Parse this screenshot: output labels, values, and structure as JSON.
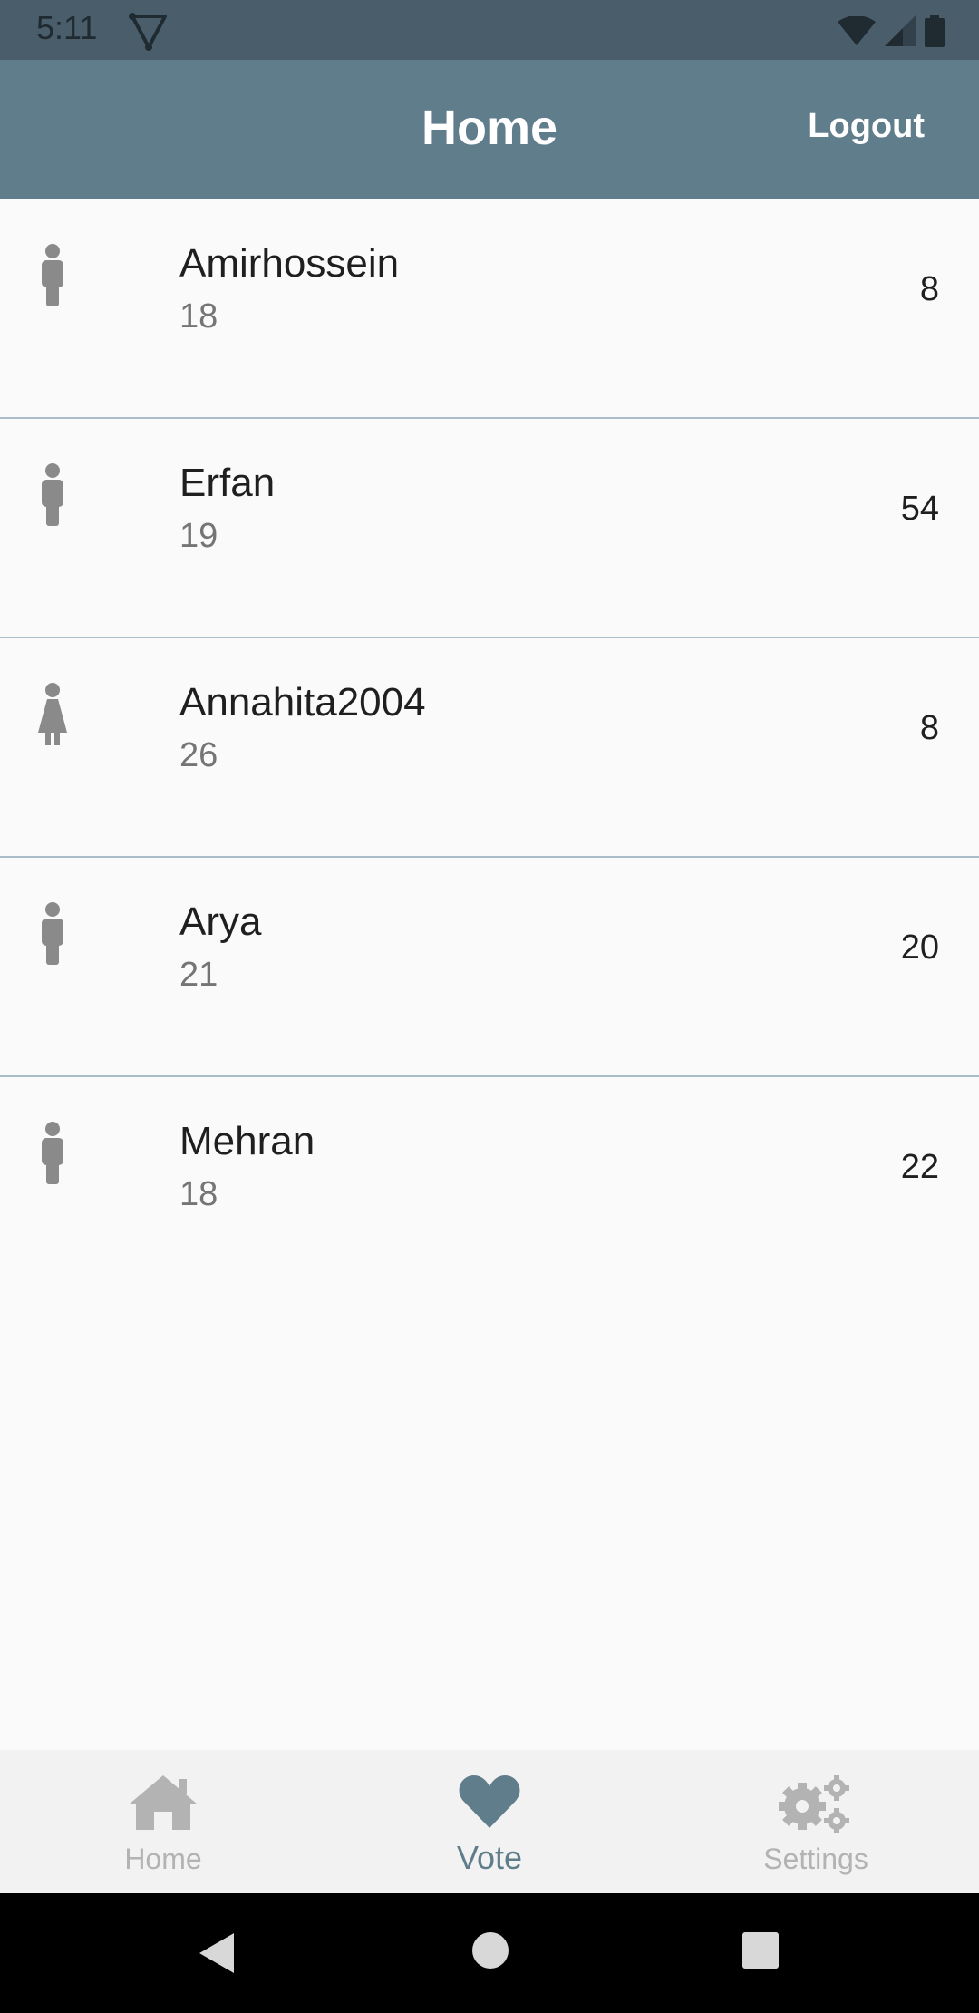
{
  "status_bar": {
    "time": "5:11"
  },
  "app_bar": {
    "title": "Home",
    "logout_label": "Logout"
  },
  "users": [
    {
      "name": "Amirhossein",
      "age": "18",
      "votes": "8",
      "gender_icon": "male-person-icon"
    },
    {
      "name": "Erfan",
      "age": "19",
      "votes": "54",
      "gender_icon": "male-person-icon"
    },
    {
      "name": "Annahita2004",
      "age": "26",
      "votes": "8",
      "gender_icon": "female-person-icon"
    },
    {
      "name": "Arya",
      "age": "21",
      "votes": "20",
      "gender_icon": "male-person-icon"
    },
    {
      "name": "Mehran",
      "age": "18",
      "votes": "22",
      "gender_icon": "male-person-icon"
    }
  ],
  "bottom_nav": {
    "items": [
      {
        "label": "Home",
        "icon": "house-icon",
        "active": false
      },
      {
        "label": "Vote",
        "icon": "heart-icon",
        "active": true
      },
      {
        "label": "Settings",
        "icon": "gears-icon",
        "active": false
      }
    ]
  },
  "colors": {
    "app_bar": "#607d8b",
    "status_bar": "#4a5d6b",
    "active_tab": "#607d8b",
    "inactive_tab": "#b3b3b3",
    "divider": "#a9bcc8"
  }
}
